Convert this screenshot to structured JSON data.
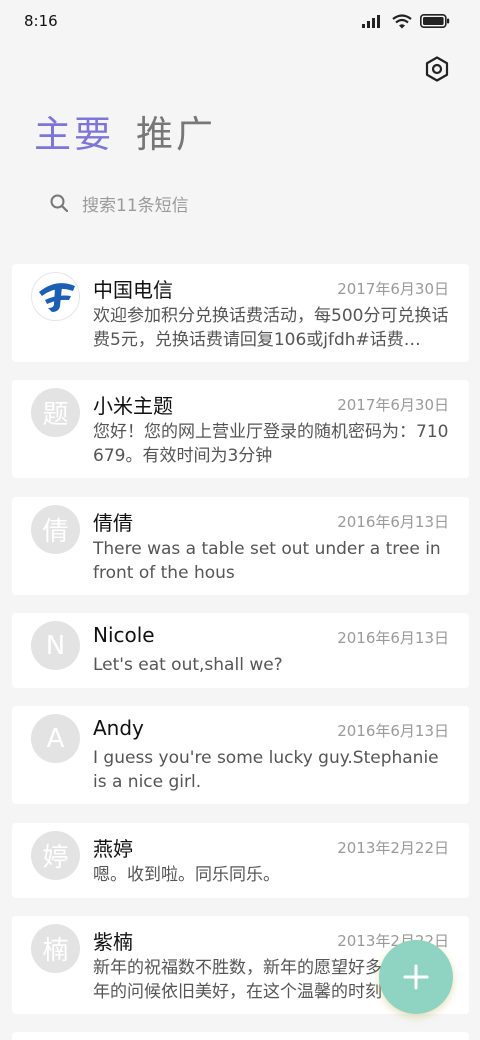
{
  "status_bar": {
    "time": "8:16",
    "icons": [
      "signal-icon",
      "wifi-icon",
      "battery-icon"
    ]
  },
  "header": {
    "settings_icon": "settings-icon",
    "tabs": [
      {
        "label": "主要",
        "active": true
      },
      {
        "label": "推广",
        "active": false
      }
    ]
  },
  "search": {
    "icon": "search-icon",
    "placeholder": "搜索11条短信"
  },
  "conversations": [
    {
      "avatar": "",
      "avatar_icon": "china-telecom-logo",
      "name": "中国电信",
      "date": "2017年6月30日",
      "preview": "欢迎参加积分兑换话费活动，每500分可兑换话费5元，兑换话费请回复106或jfdh#话费…"
    },
    {
      "avatar": "题",
      "name": "小米主题",
      "date": "2017年6月30日",
      "preview": "您好！您的网上营业厅登录的随机密码为：710679。有效时间为3分钟"
    },
    {
      "avatar": "倩",
      "name": "倩倩",
      "date": "2016年6月13日",
      "preview": "There was a table set out under a tree in front of the hous"
    },
    {
      "avatar": "N",
      "name": "Nicole",
      "date": "2016年6月13日",
      "preview": "Let's eat out,shall we?"
    },
    {
      "avatar": "A",
      "name": "Andy",
      "date": "2016年6月13日",
      "preview": "I guess you're some lucky guy.Stephanie is a nice girl."
    },
    {
      "avatar": "婷",
      "name": "燕婷",
      "date": "2013年2月22日",
      "preview": "嗯。收到啦。同乐同乐。"
    },
    {
      "avatar": "楠",
      "name": "紫楠",
      "date": "2013年2月22日",
      "preview": "新年的祝福数不胜数，新年的愿望好多好多，新年的问候依旧美好，在这个温馨的时刻"
    }
  ],
  "fab": {
    "icon": "plus-icon"
  },
  "colors": {
    "accent": "#7d76d8",
    "fab": "#8fd3c3",
    "avatar_bg": "#e3e3e3",
    "background": "#f5f5f5",
    "telecom_blue": "#1a5fb4"
  }
}
